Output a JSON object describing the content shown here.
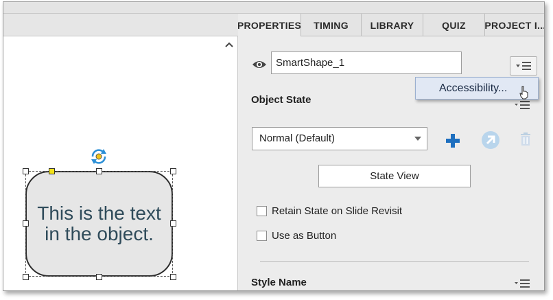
{
  "tabs": [
    {
      "label": "PROPERTIES",
      "active": true
    },
    {
      "label": "TIMING",
      "active": false
    },
    {
      "label": "LIBRARY",
      "active": false
    },
    {
      "label": "QUIZ",
      "active": false
    },
    {
      "label": "PROJECT I...",
      "active": false
    }
  ],
  "stage": {
    "shape_text": "This is the text in the object.",
    "scroll_icon": "chevron-up-icon"
  },
  "properties": {
    "object_name": "SmartShape_1",
    "popup_menu_item": "Accessibility...",
    "object_state_title": "Object State",
    "state_select_value": "Normal (Default)",
    "state_view_label": "State View",
    "retain_state_label": "Retain State on Slide Revisit",
    "retain_state_checked": false,
    "use_as_button_label": "Use as Button",
    "use_as_button_checked": false,
    "style_name_title": "Style Name"
  },
  "colors": {
    "accent_blue": "#1e6fbf",
    "selection_handle": "#f3e21a",
    "shape_text": "#2f4b5a",
    "popup_bg": "#e1e8f4"
  },
  "icons": [
    "eye-icon",
    "panel-menu-icon",
    "add-state-icon",
    "goto-state-icon",
    "delete-state-icon",
    "rotate-icon"
  ]
}
